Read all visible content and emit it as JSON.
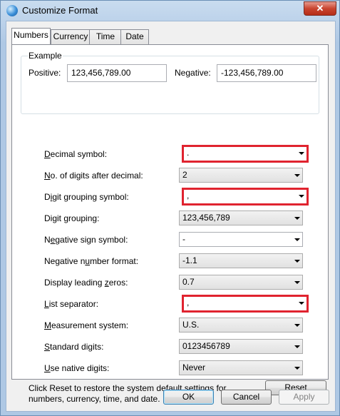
{
  "window": {
    "title": "Customize Format",
    "close_glyph": "✕"
  },
  "tabs": [
    {
      "label": "Numbers",
      "active": true
    },
    {
      "label": "Currency",
      "active": false
    },
    {
      "label": "Time",
      "active": false
    },
    {
      "label": "Date",
      "active": false
    }
  ],
  "example": {
    "group_label": "Example",
    "positive_label": "Positive:",
    "positive_value": "123,456,789.00",
    "negative_label": "Negative:",
    "negative_value": "-123,456,789.00"
  },
  "settings": [
    {
      "ak": "D",
      "rest": "ecimal symbol:",
      "value": ".",
      "editable": true,
      "highlighted": true
    },
    {
      "ak": "N",
      "rest": "o. of digits after decimal:",
      "value": "2",
      "editable": false,
      "highlighted": false
    },
    {
      "ak": "",
      "pre": "D",
      "ak2": "i",
      "rest": "git grouping symbol:",
      "value": ",",
      "editable": true,
      "highlighted": true
    },
    {
      "ak": "",
      "pre": "Digit ",
      "ak2": "g",
      "rest": "rouping:",
      "value": "123,456,789",
      "editable": false,
      "highlighted": false
    },
    {
      "ak": "",
      "pre": "N",
      "ak2": "e",
      "rest": "gative sign symbol:",
      "value": "-",
      "editable": true,
      "highlighted": false
    },
    {
      "ak": "",
      "pre": "Negative n",
      "ak2": "u",
      "rest": "mber format:",
      "value": "-1.1",
      "editable": false,
      "highlighted": false
    },
    {
      "ak": "",
      "pre": "Display leading ",
      "ak2": "z",
      "rest": "eros:",
      "value": "0.7",
      "editable": false,
      "highlighted": false
    },
    {
      "ak": "L",
      "rest": "ist separator:",
      "value": ",",
      "editable": true,
      "highlighted": true
    },
    {
      "ak": "M",
      "rest": "easurement system:",
      "value": "U.S.",
      "editable": false,
      "highlighted": false
    },
    {
      "ak": "S",
      "rest": "tandard digits:",
      "value": "0123456789",
      "editable": false,
      "highlighted": false
    },
    {
      "ak": "U",
      "rest": "se native digits:",
      "value": "Never",
      "editable": false,
      "highlighted": false
    }
  ],
  "footer": {
    "note": "Click Reset to restore the system default settings for numbers, currency, time, and date.",
    "reset_ak": "R",
    "reset_rest": "eset",
    "ok_label": "OK",
    "cancel_label": "Cancel",
    "apply_label": "Apply"
  },
  "colors": {
    "highlight": "#e0232f",
    "default_button_border": "#3c7fb1"
  }
}
